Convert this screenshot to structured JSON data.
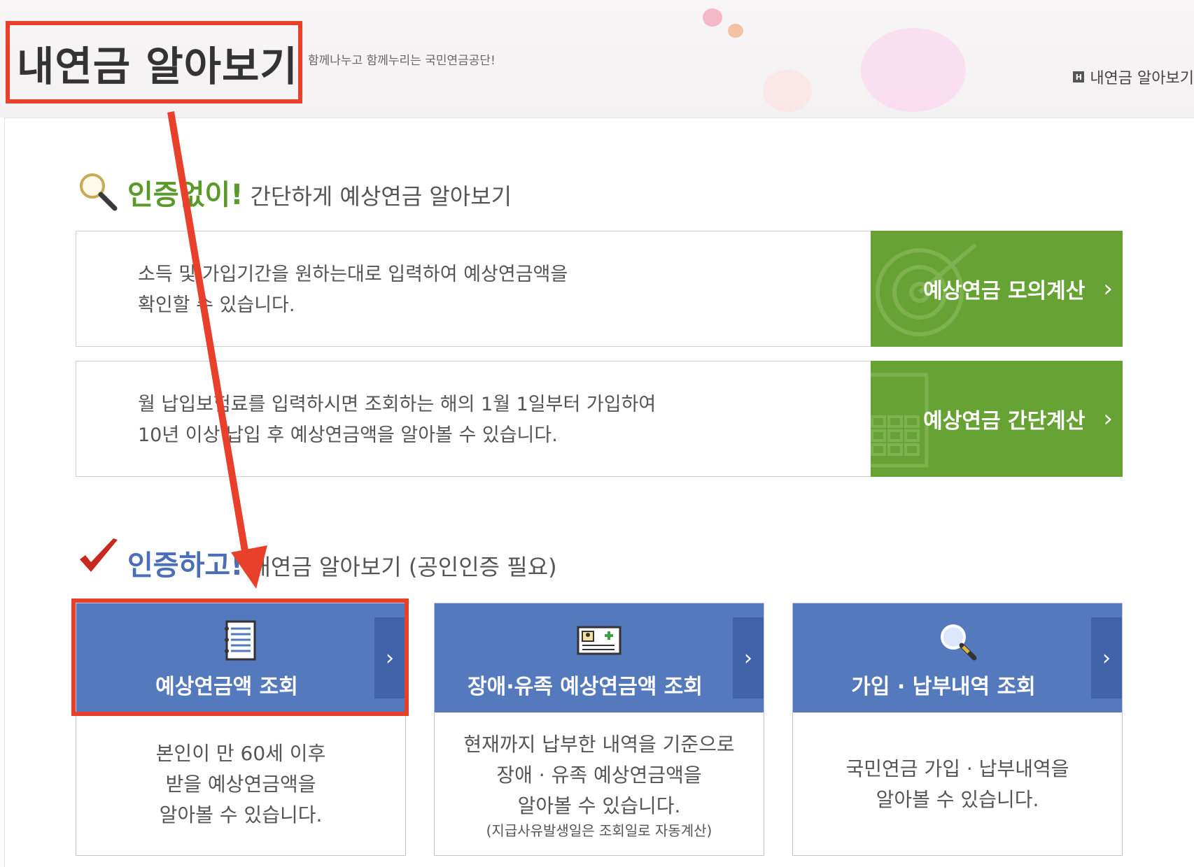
{
  "header": {
    "title": "내연금 알아보기",
    "slogan": "함께나누고 함께누리는 국민연금공단!",
    "breadcrumb": "내연금 알아보기",
    "breadcrumb_icon": "H"
  },
  "section_no_cert": {
    "title_strong": "인증없이!",
    "title_rest": "간단하게 예상연금 알아보기",
    "accent_color": "#5a9a2a",
    "rows": [
      {
        "text_line1": "소득 및 가입기간을 원하는대로 입력하여 예상연금액을",
        "text_line2": "확인할 수 있습니다.",
        "button_label": "예상연금 모의계산",
        "chevron": "›"
      },
      {
        "text_line1": "월 납입보험료를 입력하시면 조회하는 해의 1월 1일부터 가입하여",
        "text_line2": "10년 이상 납입 후 예상연금액을 알아볼 수 있습니다.",
        "button_label": "예상연금 간단계산",
        "chevron": "›"
      }
    ]
  },
  "section_cert": {
    "title_strong": "인증하고!",
    "title_rest": "내연금 알아보기 (공인인증 필요)",
    "accent_color": "#4a6fb8",
    "cards": [
      {
        "label": "예상연금액 조회",
        "icon": "document-icon",
        "desc": [
          "본인이 만 60세 이후",
          "받을 예상연금액을",
          "알아볼 수 있습니다."
        ],
        "note": "",
        "chevron": "›"
      },
      {
        "label": "장애·유족 예상연금액 조회",
        "icon": "id-card-icon",
        "desc": [
          "현재까지 납부한 내역을 기준으로",
          "장애 · 유족 예상연금액을",
          "알아볼 수 있습니다."
        ],
        "note": "(지급사유발생일은 조회일로 자동계산)",
        "chevron": "›"
      },
      {
        "label": "가입 · 납부내역 조회",
        "icon": "magnifier-icon",
        "desc": [
          "국민연금 가입 · 납부내역을",
          "알아볼 수 있습니다."
        ],
        "note": "",
        "chevron": "›"
      }
    ]
  },
  "colors": {
    "green_button": "#66a234",
    "blue_card": "#5479bd",
    "blue_card_side": "#3f63a6",
    "annotation_red": "#e8402a"
  }
}
